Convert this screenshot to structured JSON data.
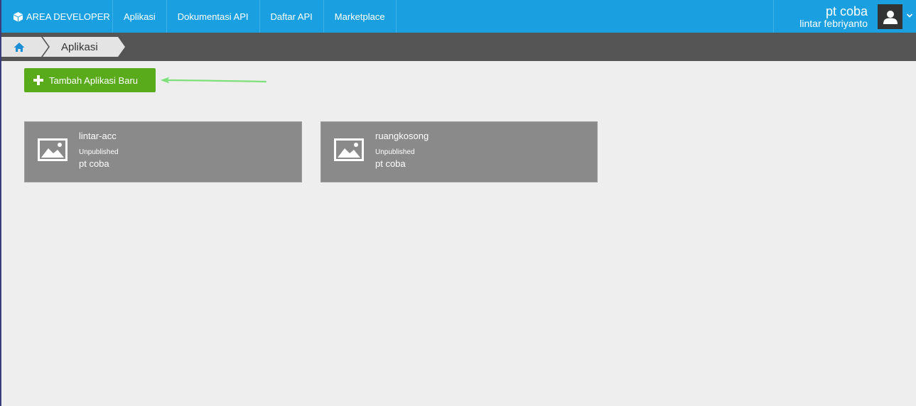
{
  "header": {
    "brand": "AREA DEVELOPER",
    "nav": [
      {
        "label": "Aplikasi"
      },
      {
        "label": "Dokumentasi API"
      },
      {
        "label": "Daftar API"
      },
      {
        "label": "Marketplace"
      }
    ],
    "user": {
      "company": "pt coba",
      "name": "lintar febriyanto"
    }
  },
  "breadcrumb": {
    "home_icon": "home-icon",
    "current": "Aplikasi"
  },
  "actions": {
    "add_app_label": "Tambah Aplikasi Baru"
  },
  "apps": [
    {
      "name": "lintar-acc",
      "status": "Unpublished",
      "owner": "pt coba",
      "icon": "image-placeholder-icon"
    },
    {
      "name": "ruangkosong",
      "status": "Unpublished",
      "owner": "pt coba",
      "icon": "image-placeholder-icon"
    }
  ],
  "colors": {
    "topbar": "#1aa0e0",
    "crumbbar": "#555555",
    "button": "#5aab1c",
    "card": "#8a8a8a",
    "arrow": "#7ee07a"
  }
}
